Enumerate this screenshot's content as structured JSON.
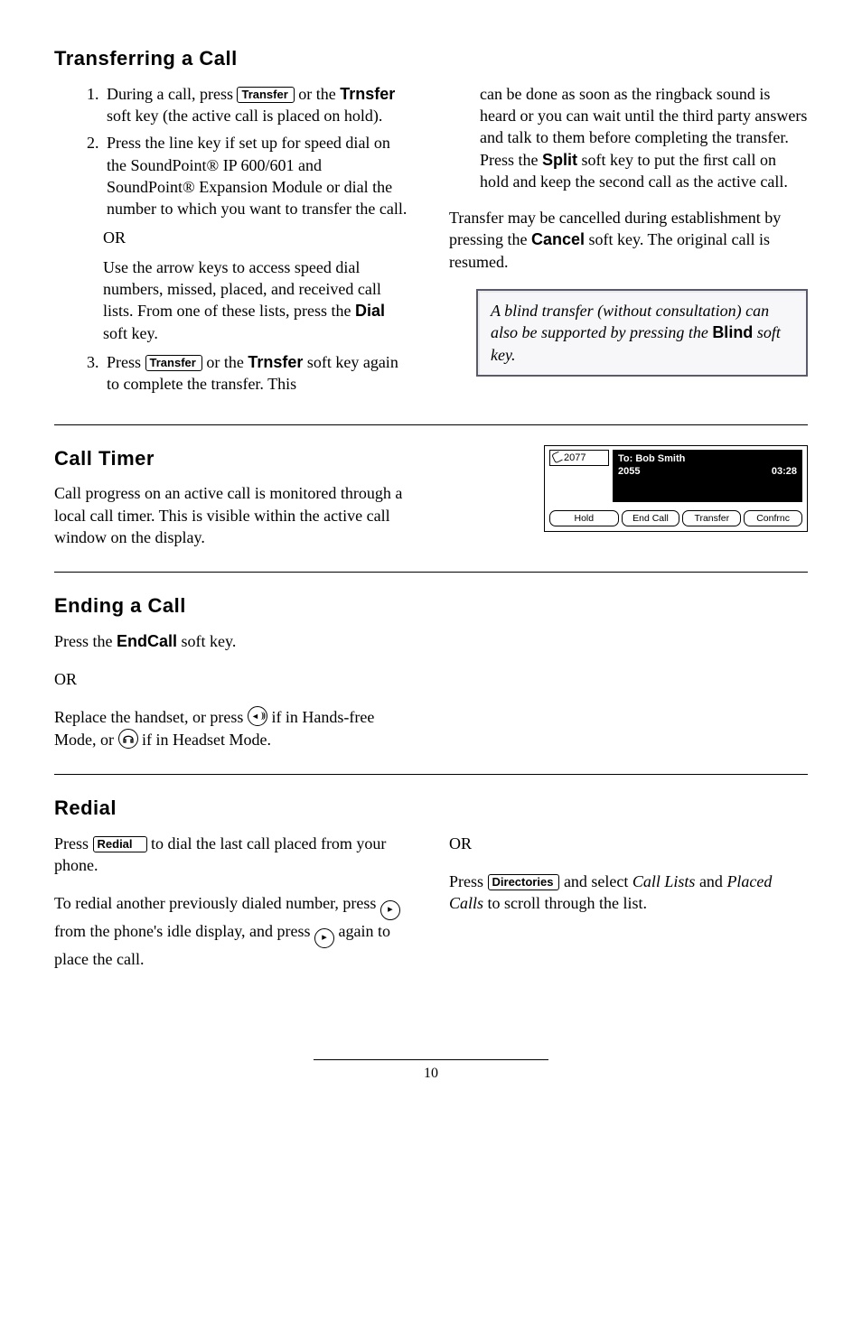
{
  "s1": {
    "title": "Transferring a Call",
    "li1a": "During a call, press ",
    "li1b": " or the ",
    "li1c": " soft key (the active call is placed on hold).",
    "li2": "Press the line key if set up for speed dial on the SoundPoint® IP 600/601 and SoundPoint® Expansion Module or dial the number to which you want to transfer the call.",
    "or": "OR",
    "sub1a": "Use the arrow keys to access speed dial numbers, missed, placed, and received call lists.  From one of these lists, press the ",
    "sub1b": " soft key.",
    "li3a": "Press ",
    "li3b": " or the ",
    "li3c": " soft key again to complete the transfer.  This",
    "r1a": "can be done as soon as the ringback sound is heard or you can wait until the third party answers and talk to them before completing the transfer.  Press the ",
    "r1b": " soft key to put the ﬁrst call on hold and keep the second call as the active call.",
    "r2a": "Transfer may be cancelled during establishment by pressing the ",
    "r2b": " soft key. The original call is resumed.",
    "note_a": "A blind transfer (without consultation) can also be supported by pressing the ",
    "note_b": " soft key."
  },
  "keys": {
    "transfer": "Transfer",
    "redial": "Redial",
    "directories": "Directories"
  },
  "soft": {
    "trnsfer": "Trnsfer",
    "dial": "Dial",
    "split": "Split",
    "cancel": "Cancel",
    "blind": "Blind",
    "endcall": "EndCall"
  },
  "s2": {
    "title": "Call Timer",
    "body": "Call progress on an active call is monitored through a local call timer.  This is visible within the active call window on the display."
  },
  "lcd": {
    "ext": "2077",
    "to": "To: Bob Smith",
    "num": "2055",
    "time": "03:28",
    "b1": "Hold",
    "b2": "End Call",
    "b3": "Transfer",
    "b4": "Confrnc"
  },
  "s3": {
    "title": "Ending a Call",
    "p1a": "Press the ",
    "p1b": " soft key.",
    "or": "OR",
    "p2a": "Replace the handset, or press ",
    "p2b": " if in Hands-free Mode, or ",
    "p2c": " if in Headset Mode."
  },
  "s4": {
    "title": "Redial",
    "l1a": "Press ",
    "l1b": " to dial the last call placed from your phone.",
    "l2a": "To redial another previously dialed number, press ",
    "l2b": " from the phone's idle display, and press ",
    "l2c": " again to place the call.",
    "or": "OR",
    "r1a": "Press ",
    "r1b": " and select  ",
    "r1c": " and ",
    "r1d": " to scroll through the list.",
    "calllists": "Call Lists",
    "placed": "Placed Calls"
  },
  "pagenum": "10"
}
